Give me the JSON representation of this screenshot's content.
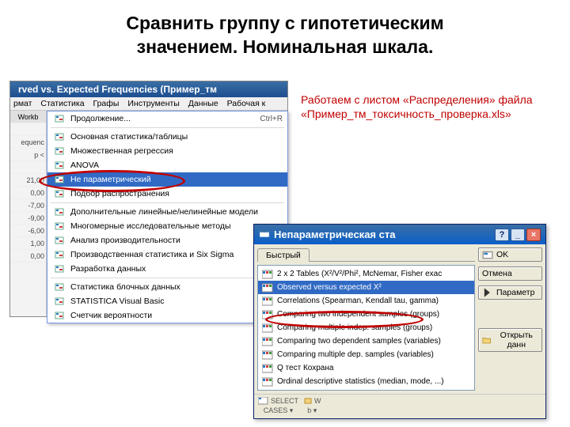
{
  "slide": {
    "title_line1": "Сравнить группу с гипотетическим",
    "title_line2": "значением. Номинальная шкала."
  },
  "note": {
    "line1": "Работаем с листом «Распределения» файла",
    "line2": "«Пример_тм_токсичность_проверка.xls»"
  },
  "shot1": {
    "window_title": "rved vs. Expected Frequencies (Пример_тм",
    "menubar": [
      "рмат",
      "Статистика",
      "Графы",
      "Инструменты",
      "Данные",
      "Рабочая к"
    ],
    "left_labels": [
      "Workb",
      "",
      "equenc",
      "p <",
      "",
      "21,00",
      "0,00",
      "-7,00",
      "-9,00",
      "-6,00",
      "1,00",
      "0,00"
    ],
    "items": [
      {
        "label": "Продолжение...",
        "shortcut": "Ctrl+R"
      },
      {
        "sep": true
      },
      {
        "label": "Основная статистика/таблицы"
      },
      {
        "label": "Множественная регрессия"
      },
      {
        "label": "ANOVA"
      },
      {
        "label": "Не параметрический",
        "highlight": true
      },
      {
        "label": "Подбор распространения"
      },
      {
        "sep": true
      },
      {
        "label": "Дополнительные линейные/нелинейные модели"
      },
      {
        "label": "Многомерные исследовательные методы"
      },
      {
        "label": "Анализ производительности"
      },
      {
        "label": "Производственная статистика и Six Sigma"
      },
      {
        "label": "Разработка данных"
      },
      {
        "sep": true
      },
      {
        "label": "Статистика блочных данных"
      },
      {
        "label": "STATISTICA Visual Basic"
      },
      {
        "label": "Счетчик вероятности"
      }
    ]
  },
  "shot2": {
    "window_title": "Непараметрическая ста",
    "help": "?",
    "min": "_",
    "close": "×",
    "tab": "Быстрый",
    "list": [
      {
        "label": "2 x 2 Tables (X²/V²/Phi², McNemar, Fisher exac"
      },
      {
        "label": "Observed versus expected X²",
        "selected": true
      },
      {
        "label": "Correlations (Spearman, Kendall tau, gamma)"
      },
      {
        "label": "Comparing two independent samples (groups)"
      },
      {
        "label": "Comparing multiple indep. samples (groups)"
      },
      {
        "label": "Comparing two dependent samples (variables)"
      },
      {
        "label": "Comparing multiple dep. samples (variables)"
      },
      {
        "label": "Q тест Кохрана"
      },
      {
        "label": "Ordinal descriptive statistics (median, mode, ...)"
      }
    ],
    "buttons": {
      "ok": "OK",
      "cancel": "Отмена",
      "options": "Параметр",
      "open": "Открыть данн"
    },
    "footer": {
      "select_cases_top": "SELECT",
      "select_cases_bot": "CASES",
      "w_top": "W",
      "w_bot": "b"
    }
  }
}
